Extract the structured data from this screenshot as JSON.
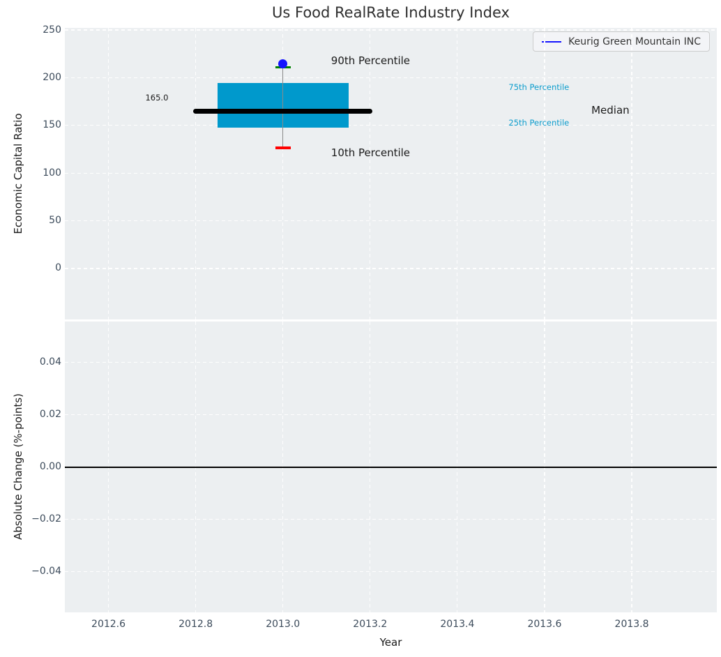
{
  "chart_data": [
    {
      "type": "box",
      "title": "Us Food RealRate Industry Index",
      "ylabel": "Economic Capital Ratio",
      "xlabel": "",
      "xlim": [
        2012.5,
        2013.995
      ],
      "ylim": [
        -53.4,
        252.2
      ],
      "grid": "white-dashed",
      "xticks": [
        {
          "v": 2012.6,
          "label": "2012.6"
        },
        {
          "v": 2012.8,
          "label": "2012.8"
        },
        {
          "v": 2013.0,
          "label": "2013.0"
        },
        {
          "v": 2013.2,
          "label": "2013.2"
        },
        {
          "v": 2013.4,
          "label": "2013.4"
        },
        {
          "v": 2013.6,
          "label": "2013.6"
        },
        {
          "v": 2013.8,
          "label": "2013.8"
        }
      ],
      "show_x_tick_labels": false,
      "yticks": [
        {
          "v": 0,
          "label": "0"
        },
        {
          "v": 50,
          "label": "50"
        },
        {
          "v": 100,
          "label": "100"
        },
        {
          "v": 150,
          "label": "150"
        },
        {
          "v": 200,
          "label": "200"
        },
        {
          "v": 250,
          "label": "250"
        }
      ],
      "legend": {
        "label": "Keurig Green Mountain INC",
        "color": "#1414ff",
        "position": "upper right"
      },
      "box": {
        "x_center": 2013.0,
        "p10": 126.5,
        "p25": 147.3,
        "median": 165.0,
        "p75": 194.3,
        "p90": 211.0,
        "box_x": [
          2012.85,
          2013.15
        ],
        "median_x": [
          2012.795,
          2013.205
        ],
        "cap_x": [
          2012.983,
          2013.018
        ]
      },
      "company_point": {
        "name": "Keurig Green Mountain INC",
        "x": 2013.0,
        "y": 214.5
      },
      "annotations": [
        {
          "id": "median-value-label",
          "text": "165.0",
          "x": 2012.711,
          "y": 179,
          "size": "sm",
          "color": "#1a1a1a"
        },
        {
          "id": "p90-label",
          "text": "90th Percentile",
          "x": 2013.201,
          "y": 218,
          "size": "md",
          "color": "#1a1a1a"
        },
        {
          "id": "p10-label",
          "text": "10th Percentile",
          "x": 2013.201,
          "y": 121,
          "size": "md",
          "color": "#1a1a1a"
        },
        {
          "id": "p75-label",
          "text": "75th Percentile",
          "x": 2013.587,
          "y": 190,
          "size": "sm",
          "color": "#0d9dcd"
        },
        {
          "id": "p25-label",
          "text": "25th Percentile",
          "x": 2013.587,
          "y": 153,
          "size": "sm",
          "color": "#0d9dcd"
        },
        {
          "id": "median-label",
          "text": "Median",
          "x": 2013.751,
          "y": 166,
          "size": "md",
          "color": "#1a1a1a"
        }
      ],
      "colors": {
        "box": "#0099cc",
        "median": "#000000",
        "whisker": "#8a8a8a",
        "cap_top": "#008000",
        "cap_bottom": "#ff0000",
        "point": "#1414ff",
        "axes_bg": "#eceff1",
        "grid": "#ffffff",
        "tick": "#3b4a5a"
      }
    },
    {
      "type": "line",
      "title": "",
      "ylabel": "Absolute Change (%-points)",
      "xlabel": "Year",
      "xlim": [
        2012.5,
        2013.995
      ],
      "ylim": [
        -0.0556,
        0.0557
      ],
      "grid": "white-dashed",
      "xticks": [
        {
          "v": 2012.6,
          "label": "2012.6"
        },
        {
          "v": 2012.8,
          "label": "2012.8"
        },
        {
          "v": 2013.0,
          "label": "2013.0"
        },
        {
          "v": 2013.2,
          "label": "2013.2"
        },
        {
          "v": 2013.4,
          "label": "2013.4"
        },
        {
          "v": 2013.6,
          "label": "2013.6"
        },
        {
          "v": 2013.8,
          "label": "2013.8"
        }
      ],
      "show_x_tick_labels": true,
      "yticks": [
        {
          "v": 0.04,
          "label": "0.04"
        },
        {
          "v": 0.02,
          "label": "0.02"
        },
        {
          "v": 0.0,
          "label": "0.00"
        },
        {
          "v": -0.02,
          "label": "−0.02"
        },
        {
          "v": -0.04,
          "label": "−0.04"
        }
      ],
      "zero_line_y": 0.0,
      "series": []
    }
  ]
}
